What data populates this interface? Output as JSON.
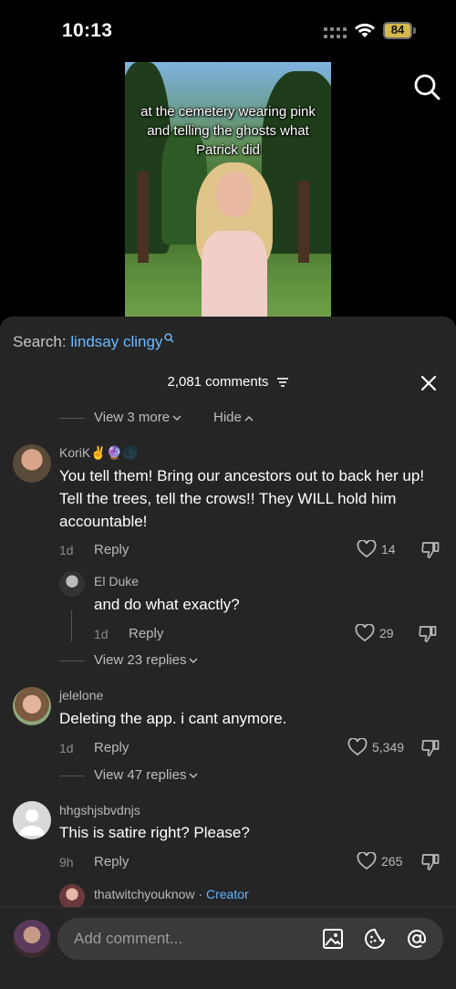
{
  "status_bar": {
    "time": "10:13",
    "battery": "84"
  },
  "video": {
    "caption": "at the cemetery wearing pink and telling the ghosts what Patrick did"
  },
  "search": {
    "label": "Search:",
    "term": "lindsay clingy"
  },
  "comments_header": {
    "count_label": "2,081 comments"
  },
  "top_thread": {
    "view_more": "View 3 more",
    "hide": "Hide"
  },
  "comments": [
    {
      "name": "KoriK✌️🔮🌑",
      "text": "You tell them! Bring our ancestors out to back her up! Tell the trees, tell the crows!! They WILL hold him accountable!",
      "age": "1d",
      "reply_label": "Reply",
      "likes": "14",
      "reply": {
        "name": "El Duke",
        "text": "and do what exactly?",
        "age": "1d",
        "reply_label": "Reply",
        "likes": "29"
      },
      "view_replies": "View 23 replies"
    },
    {
      "name": "jelelone",
      "text": "Deleting the app. i cant anymore.",
      "age": "1d",
      "reply_label": "Reply",
      "likes": "5,349",
      "view_replies": "View 47 replies"
    },
    {
      "name": "hhgshjsbvdnjs",
      "text": "This is satire right? Please?",
      "age": "9h",
      "reply_label": "Reply",
      "likes": "265"
    }
  ],
  "partial_reply": {
    "name": "thatwitchyouknow",
    "separator": " · ",
    "badge": "Creator"
  },
  "composer": {
    "placeholder": "Add comment..."
  },
  "icons": [
    "search-icon",
    "sort-icon",
    "close-icon",
    "heart-icon",
    "dislike-icon",
    "image-icon",
    "emoji-icon",
    "mention-icon"
  ],
  "colors": {
    "accent_blue": "#6fb8ff",
    "sheet_bg": "#252525",
    "input_bg": "#3a3a3a"
  }
}
